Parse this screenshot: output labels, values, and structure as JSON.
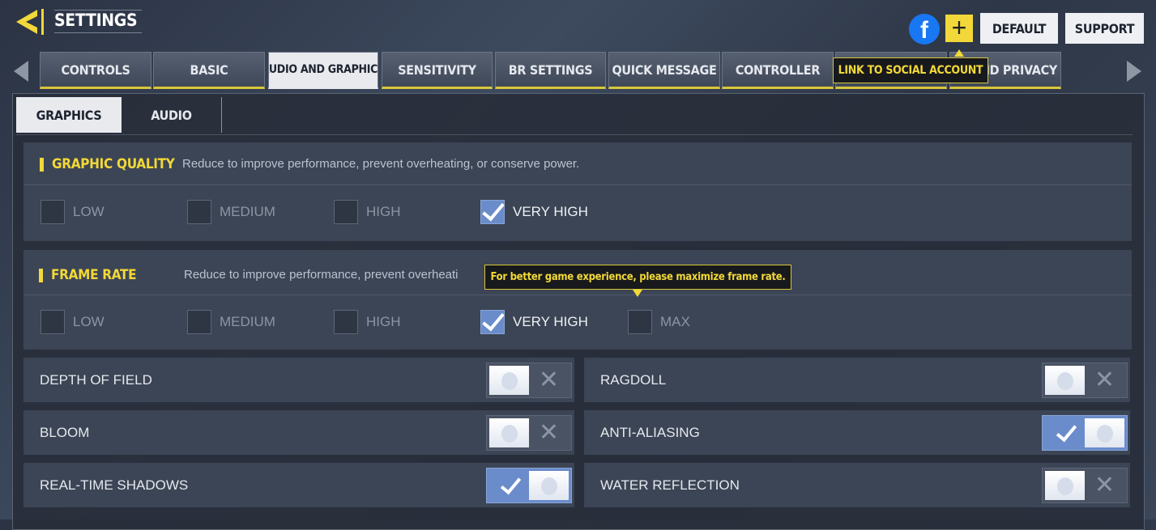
{
  "header": {
    "title": "SETTINGS",
    "default_label": "DEFAULT",
    "support_label": "SUPPORT",
    "icons": [
      "back-arrow-icon",
      "facebook-icon",
      "plus-icon"
    ]
  },
  "tabs": [
    {
      "label": "CONTROLS",
      "active": false
    },
    {
      "label": "BASIC",
      "active": false
    },
    {
      "label": "AUDIO AND GRAPHICS",
      "active": true
    },
    {
      "label": "SENSITIVITY",
      "active": false
    },
    {
      "label": "BR SETTINGS",
      "active": false
    },
    {
      "label": "QUICK MESSAGE",
      "active": false
    },
    {
      "label": "CONTROLLER",
      "active": false
    },
    {
      "label": "",
      "active": false
    },
    {
      "label": "AL AND PRIVACY",
      "active": false
    }
  ],
  "social_tooltip": "LINK TO SOCIAL ACCOUNT",
  "subtabs": {
    "graphics": "GRAPHICS",
    "audio": "AUDIO",
    "active": "GRAPHICS"
  },
  "graphic_quality": {
    "title": "GRAPHIC QUALITY",
    "description": "Reduce to improve performance, prevent overheating, or conserve power.",
    "options": [
      {
        "label": "LOW",
        "checked": false
      },
      {
        "label": "MEDIUM",
        "checked": false
      },
      {
        "label": "HIGH",
        "checked": false
      },
      {
        "label": "VERY HIGH",
        "checked": true
      }
    ]
  },
  "frame_rate": {
    "title": "FRAME RATE",
    "description": "Reduce to improve performance, prevent overheati",
    "tooltip": "For better game experience, please maximize frame rate.",
    "options": [
      {
        "label": "LOW",
        "checked": false
      },
      {
        "label": "MEDIUM",
        "checked": false
      },
      {
        "label": "HIGH",
        "checked": false
      },
      {
        "label": "VERY HIGH",
        "checked": true
      },
      {
        "label": "MAX",
        "checked": false
      }
    ]
  },
  "toggles": [
    {
      "label": "DEPTH OF FIELD",
      "on": false
    },
    {
      "label": "RAGDOLL",
      "on": false
    },
    {
      "label": "BLOOM",
      "on": false
    },
    {
      "label": "ANTI-ALIASING",
      "on": true
    },
    {
      "label": "REAL-TIME SHADOWS",
      "on": true
    },
    {
      "label": "WATER REFLECTION",
      "on": false
    }
  ],
  "colors": {
    "accent": "#f2d838",
    "toggle_on": "#6a8ccb",
    "facebook": "#1877f2"
  }
}
